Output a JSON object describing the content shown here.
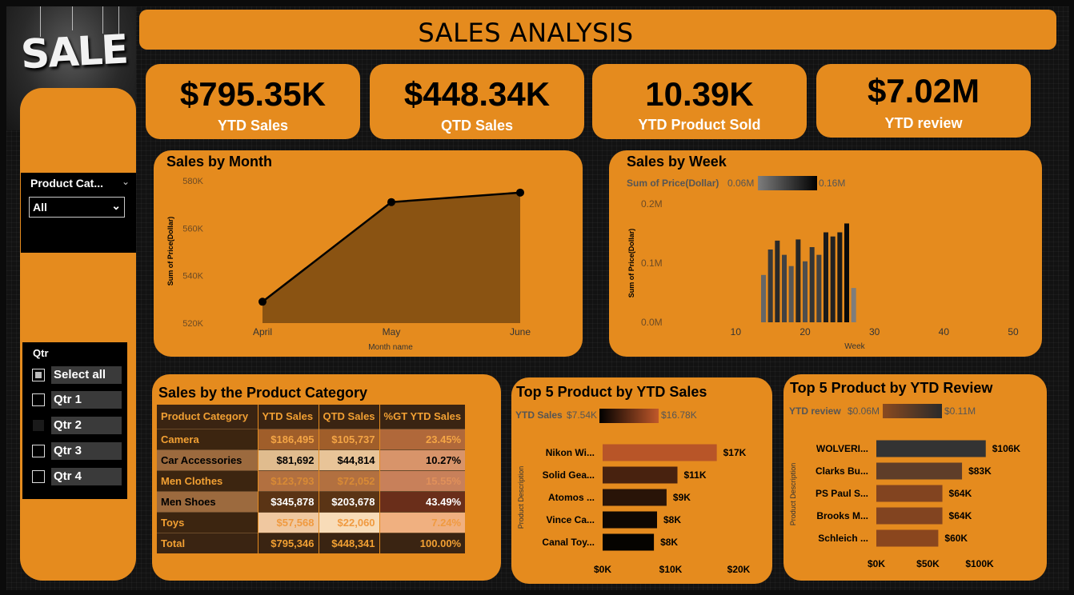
{
  "logo": {
    "text": "SALE"
  },
  "title": "SALES ANALYSIS",
  "kpis": [
    {
      "value": "$795.35K",
      "label": "YTD Sales"
    },
    {
      "value": "$448.34K",
      "label": "QTD Sales"
    },
    {
      "value": "10.39K",
      "label": "YTD Product Sold"
    },
    {
      "value": "$7.02M",
      "label": "YTD review"
    }
  ],
  "slicers": {
    "product_category": {
      "label": "Product Cat...",
      "selected": "All"
    },
    "qtr": {
      "label": "Qtr",
      "items": [
        {
          "label": "Select all",
          "state": "partial"
        },
        {
          "label": "Qtr 1",
          "state": "unchecked"
        },
        {
          "label": "Qtr 2",
          "state": "checked"
        },
        {
          "label": "Qtr 3",
          "state": "unchecked"
        },
        {
          "label": "Qtr 4",
          "state": "unchecked"
        }
      ]
    }
  },
  "sales_by_month": {
    "title": "Sales by Month",
    "xlabel": "Month name",
    "ylabel": "Sum of Price(Dollar)",
    "y_ticks": [
      "580K",
      "560K",
      "540K",
      "520K"
    ]
  },
  "sales_by_week": {
    "title": "Sales by Week",
    "legend_label": "Sum of Price(Dollar)",
    "legend_min": "0.06M",
    "legend_max": "0.16M",
    "xlabel": "Week",
    "ylabel": "Sum of Price(Dollar)",
    "y_ticks": [
      "0.2M",
      "0.1M",
      "0.0M"
    ],
    "x_ticks": [
      "10",
      "20",
      "30",
      "40",
      "50"
    ]
  },
  "category_table": {
    "title": "Sales by the Product Category",
    "headers": [
      "Product Category",
      "YTD Sales",
      "QTD Sales",
      "%GT YTD Sales"
    ],
    "rows": [
      [
        "Camera",
        "$186,495",
        "$105,737",
        "23.45%"
      ],
      [
        "Car Accessories",
        "$81,692",
        "$44,814",
        "10.27%"
      ],
      [
        "Men Clothes",
        "$123,793",
        "$72,052",
        "15.55%"
      ],
      [
        "Men Shoes",
        "$345,878",
        "$203,678",
        "43.49%"
      ],
      [
        "Toys",
        "$57,568",
        "$22,060",
        "7.24%"
      ]
    ],
    "total": [
      "Total",
      "$795,346",
      "$448,341",
      "100.00%"
    ]
  },
  "top5_sales": {
    "title": "Top 5 Product by YTD Sales",
    "legend_label": "YTD Sales",
    "legend_min": "$7.54K",
    "legend_max": "$16.78K",
    "ylabel": "Product Description",
    "x_ticks": [
      "$0K",
      "$10K",
      "$20K"
    ],
    "items": [
      {
        "name": "Nikon Wi...",
        "label": "$17K"
      },
      {
        "name": "Solid Gea...",
        "label": "$11K"
      },
      {
        "name": "Atomos ...",
        "label": "$9K"
      },
      {
        "name": "Vince Ca...",
        "label": "$8K"
      },
      {
        "name": "Canal Toy...",
        "label": "$8K"
      }
    ]
  },
  "top5_review": {
    "title": "Top 5 Product by YTD Review",
    "legend_label": "YTD review",
    "legend_min": "$0.06M",
    "legend_max": "$0.11M",
    "ylabel": "Product Description",
    "x_ticks": [
      "$0K",
      "$50K",
      "$100K"
    ],
    "items": [
      {
        "name": "WOLVERI...",
        "label": "$106K"
      },
      {
        "name": "Clarks Bu...",
        "label": "$83K"
      },
      {
        "name": "PS Paul S...",
        "label": "$64K"
      },
      {
        "name": "Brooks M...",
        "label": "$64K"
      },
      {
        "name": "Schleich ...",
        "label": "$60K"
      }
    ]
  },
  "chart_data": [
    {
      "type": "area",
      "title": "Sales by Month",
      "categories": [
        "April",
        "May",
        "June"
      ],
      "values": [
        529000,
        571000,
        575000
      ],
      "xlabel": "Month name",
      "ylabel": "Sum of Price(Dollar)",
      "ylim": [
        520000,
        580000
      ]
    },
    {
      "type": "bar",
      "title": "Sales by Week",
      "x": [
        14,
        15,
        16,
        17,
        18,
        19,
        20,
        21,
        22,
        23,
        24,
        25,
        26,
        27
      ],
      "values": [
        80000,
        123000,
        138000,
        114000,
        95000,
        140000,
        103000,
        127000,
        114000,
        152000,
        145000,
        152000,
        167000,
        58000
      ],
      "xlabel": "Week",
      "ylabel": "Sum of Price(Dollar)",
      "xlim": [
        5,
        53
      ],
      "ylim": [
        0,
        200000
      ]
    },
    {
      "type": "bar",
      "title": "Top 5 Product by YTD Sales",
      "categories": [
        "Nikon Wi...",
        "Solid Gea...",
        "Atomos ...",
        "Vince Ca...",
        "Canal Toy..."
      ],
      "values": [
        16780,
        11000,
        9400,
        8000,
        7540
      ],
      "xlim": [
        0,
        20000
      ]
    },
    {
      "type": "bar",
      "title": "Top 5 Product by YTD Review",
      "categories": [
        "WOLVERI...",
        "Clarks Bu...",
        "PS Paul S...",
        "Brooks M...",
        "Schleich ..."
      ],
      "values": [
        106000,
        83000,
        64000,
        64000,
        60000
      ],
      "xlim": [
        0,
        100000
      ]
    }
  ]
}
